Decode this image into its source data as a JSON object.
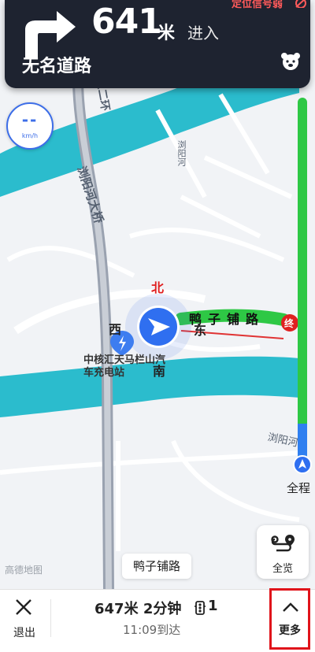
{
  "navigation": {
    "distance": "641",
    "unit": "米",
    "action": "进入",
    "road_name": "无名道路",
    "gps_signal": "定位信号弱"
  },
  "speed": {
    "value": "--",
    "unit": "km/h"
  },
  "map": {
    "labels": {
      "east_ring": "东二环",
      "bridge": "浏阳河大桥",
      "river_small": "浏阳河",
      "river_right": "浏阳河",
      "charging": "中核汇天马栏山汽车充电站",
      "route_road": "鸭子铺路"
    },
    "compass": {
      "north": "北",
      "west": "西",
      "south": "南",
      "east": "东"
    },
    "current_road": "鸭子铺路",
    "watermark": "高德地图",
    "destination_badge": "终"
  },
  "route_progress": {
    "label": "全程",
    "completed_fraction": 0.1
  },
  "overview_button": {
    "label": "全览"
  },
  "bottom_bar": {
    "exit_label": "退出",
    "trip_summary": "647米 2分钟",
    "traffic_lights": "1",
    "arrival": "11:09到达",
    "more_label": "更多"
  },
  "colors": {
    "nav_bg": "#1e2330",
    "route_green": "#2ec845",
    "route_blue": "#2f7ff0",
    "river": "#2bbccd",
    "highlight_red": "#e0141b"
  }
}
